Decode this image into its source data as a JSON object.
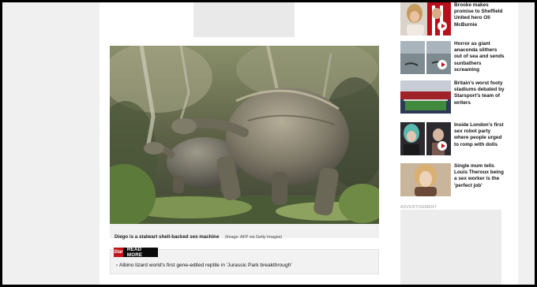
{
  "article": {
    "caption": "Diego is a stalwart shell-backed sex machine",
    "caption_credit": "(Image: AFP via Getty Images)"
  },
  "read_more": {
    "logo_text": "Star",
    "label": "READ MORE",
    "link_arrow": "›",
    "link_text": "Albino lizard world's first gene-edited reptile in 'Jurassic Park breakthrough'"
  },
  "sidebar": {
    "items": [
      {
        "title": "Brooke makes promise to Sheffield United hero Oli McBurnie",
        "has_video": true
      },
      {
        "title": "Horror as giant anaconda slithers out of sea and sends sunbathers screaming",
        "has_video": true
      },
      {
        "title": "Britain's worst footy stadiums debated by Starsport's team of writers",
        "has_video": false
      },
      {
        "title": "Inside London's first sex robot party where people urged to romp with dolls",
        "has_video": true
      },
      {
        "title": "Single mum tells Louis Theroux being a sex worker is the 'perfect job'",
        "has_video": false
      }
    ],
    "ad_label": "ADVERTISEMENT"
  },
  "colors": {
    "brand_red": "#c41218",
    "page_bg": "#f0f0f0"
  },
  "icons": [
    "play-icon",
    "chevron-right-icon"
  ]
}
